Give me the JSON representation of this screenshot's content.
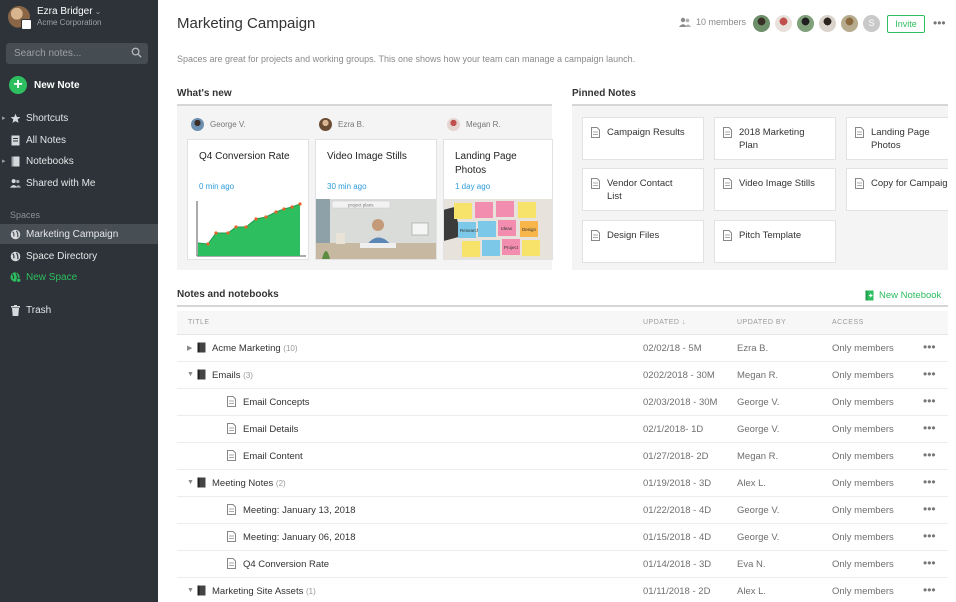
{
  "sidebar": {
    "user_name": "Ezra Bridger",
    "org": "Acme Corporation",
    "search_placeholder": "Search notes...",
    "new_note": "New Note",
    "items": [
      {
        "label": "Shortcuts",
        "icon": "star-icon"
      },
      {
        "label": "All Notes",
        "icon": "note-icon"
      },
      {
        "label": "Notebooks",
        "icon": "notebook-icon"
      },
      {
        "label": "Shared with Me",
        "icon": "people-icon"
      }
    ],
    "spaces_header": "Spaces",
    "spaces": [
      {
        "label": "Marketing Campaign",
        "icon": "globe-icon"
      },
      {
        "label": "Space Directory",
        "icon": "globe-icon"
      },
      {
        "label": "New Space",
        "icon": "globe-plus-icon"
      }
    ],
    "trash": "Trash"
  },
  "header": {
    "title": "Marketing Campaign",
    "members": "10 members",
    "extra_avatar": "S",
    "invite": "Invite",
    "description": "Spaces are great for projects and working groups. This one shows how your team can manage a campaign launch."
  },
  "whats_new": {
    "title": "What's new",
    "cards": [
      {
        "author": "George V.",
        "title": "Q4 Conversion Rate",
        "time": "0 min ago"
      },
      {
        "author": "Ezra B.",
        "title": "Video Image Stills",
        "time": "30 min ago",
        "thumb_caption": "project plans"
      },
      {
        "author": "Megan R.",
        "title": "Landing Page Photos",
        "time": "1 day ago",
        "sticky_notes": [
          "Research",
          "Ideas",
          "Design",
          "Project"
        ]
      }
    ]
  },
  "pinned": {
    "title": "Pinned Notes",
    "notes": [
      "Campaign Results",
      "2018 Marketing Plan",
      "Landing Page Photos",
      "Vendor Contact List",
      "Video Image Stills",
      "Copy for Campaign",
      "Design Files",
      "Pitch Template"
    ]
  },
  "notes": {
    "title": "Notes and notebooks",
    "new_notebook": "New Notebook",
    "columns": {
      "title": "TITLE",
      "updated": "UPDATED ↓",
      "updated_by": "UPDATED BY",
      "access": "ACCESS"
    },
    "rows": [
      {
        "type": "notebook",
        "toggle": "▶",
        "title": "Acme Marketing",
        "count": "(10)",
        "updated": "02/02/18 - 5M",
        "by": "Ezra B.",
        "access": "Only members"
      },
      {
        "type": "notebook",
        "toggle": "▼",
        "title": "Emails",
        "count": "(3)",
        "updated": "0202/2018 - 30M",
        "by": "Megan R.",
        "access": "Only members"
      },
      {
        "type": "note",
        "title": "Email Concepts",
        "updated": "02/03/2018 - 30M",
        "by": "George V.",
        "access": "Only members"
      },
      {
        "type": "note",
        "title": "Email Details",
        "updated": "02/1/2018- 1D",
        "by": "George V.",
        "access": "Only members"
      },
      {
        "type": "note",
        "title": "Email Content",
        "updated": "01/27/2018- 2D",
        "by": "Megan R.",
        "access": "Only members"
      },
      {
        "type": "notebook",
        "toggle": "▼",
        "title": "Meeting Notes",
        "count": "(2)",
        "updated": "01/19/2018 - 3D",
        "by": "Alex L.",
        "access": "Only members"
      },
      {
        "type": "note",
        "title": "Meeting: January 13, 2018",
        "updated": "01/22/2018 - 4D",
        "by": "George V.",
        "access": "Only members"
      },
      {
        "type": "note",
        "title": "Meeting: January 06, 2018",
        "updated": "01/15/2018 - 4D",
        "by": "George V.",
        "access": "Only members"
      },
      {
        "type": "note",
        "title": "Q4 Conversion Rate",
        "updated": "01/14/2018 - 3D",
        "by": "Eva N.",
        "access": "Only members"
      },
      {
        "type": "notebook",
        "toggle": "▼",
        "title": "Marketing Site Assets",
        "count": "(1)",
        "updated": "01/11/2018 - 2D",
        "by": "Alex L.",
        "access": "Only members"
      }
    ],
    "more": "•••"
  },
  "colors": {
    "sidebar_bg": "#2d3338",
    "accent_green": "#2dbe60",
    "link_blue": "#2d9cdb"
  }
}
